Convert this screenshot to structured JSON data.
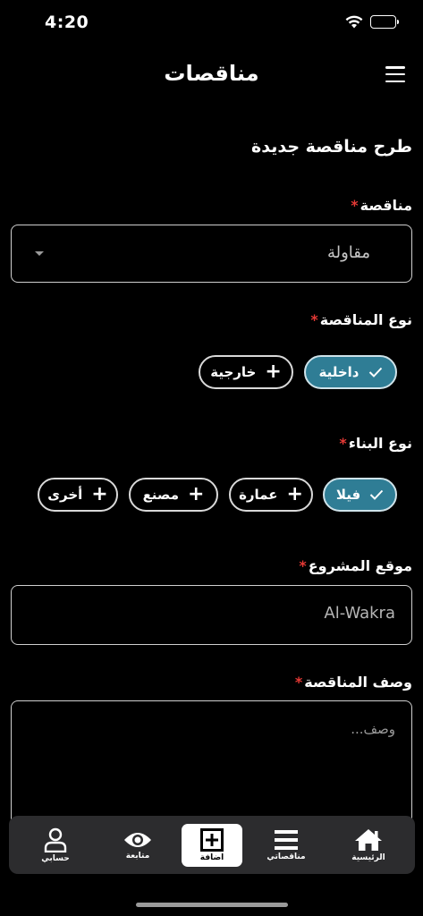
{
  "status_bar": {
    "time": "4:20"
  },
  "header": {
    "title": "مناقصات"
  },
  "form": {
    "section_title": "طرح مناقصة جديدة",
    "tender": {
      "label": "مناقصة",
      "required_mark": "*",
      "value": "مقاولة"
    },
    "tender_type": {
      "label": "نوع المناقصة",
      "required_mark": "*",
      "options": [
        {
          "label": "داخلية",
          "selected": true
        },
        {
          "label": "خارجية",
          "selected": false
        }
      ]
    },
    "building_type": {
      "label": "نوع البناء",
      "required_mark": "*",
      "options": [
        {
          "label": "فيلا",
          "selected": true
        },
        {
          "label": "عمارة",
          "selected": false
        },
        {
          "label": "مصنع",
          "selected": false
        },
        {
          "label": "أخرى",
          "selected": false
        }
      ]
    },
    "project_location": {
      "label": "موقع المشروع",
      "required_mark": "*",
      "value": "Al-Wakra"
    },
    "tender_description": {
      "label": "وصف المناقصة",
      "required_mark": "*",
      "placeholder": "وصف..."
    }
  },
  "bottom_nav": {
    "items": [
      {
        "label": "حسابي",
        "icon": "person-icon",
        "active": false
      },
      {
        "label": "متابعة",
        "icon": "eye-icon",
        "active": false
      },
      {
        "label": "اضافة",
        "icon": "add-box-icon",
        "active": true
      },
      {
        "label": "مناقصاتي",
        "icon": "list-icon",
        "active": false
      },
      {
        "label": "الرئيسية",
        "icon": "home-icon",
        "active": false
      }
    ]
  },
  "colors": {
    "background": "#000000",
    "accent": "#2f7d95",
    "required": "#e53935",
    "nav_bg": "#2c2c2e"
  }
}
